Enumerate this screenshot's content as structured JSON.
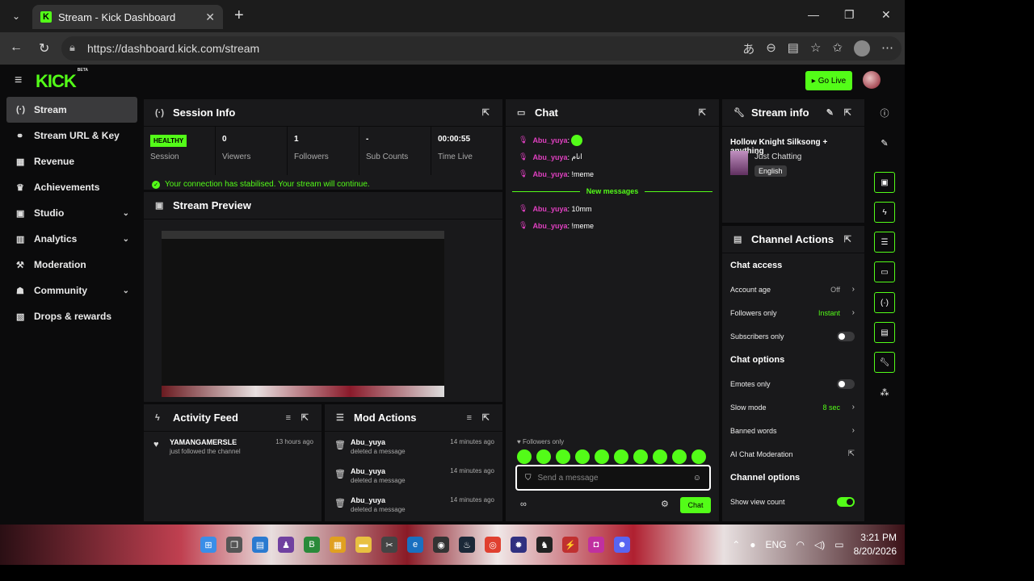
{
  "browser": {
    "tab_title": "Stream - Kick Dashboard",
    "url": "https://dashboard.kick.com/stream"
  },
  "topbar": {
    "logo": "KICK",
    "logo_badge": "BETA",
    "go_live_label": "Go Live"
  },
  "sidebar": {
    "items": [
      {
        "label": "Stream",
        "icon": "broadcast-icon",
        "active": true
      },
      {
        "label": "Stream URL & Key",
        "icon": "link-icon"
      },
      {
        "label": "Revenue",
        "icon": "revenue-icon"
      },
      {
        "label": "Achievements",
        "icon": "trophy-icon"
      },
      {
        "label": "Studio",
        "icon": "studio-icon",
        "expandable": true
      },
      {
        "label": "Analytics",
        "icon": "chart-icon",
        "expandable": true
      },
      {
        "label": "Moderation",
        "icon": "hammer-icon"
      },
      {
        "label": "Community",
        "icon": "community-icon",
        "expandable": true
      },
      {
        "label": "Drops & rewards",
        "icon": "gift-icon"
      }
    ]
  },
  "session": {
    "title": "Session Info",
    "health_badge": "HEALTHY",
    "health_label": "Session",
    "viewers_value": "0",
    "viewers_label": "Viewers",
    "followers_value": "1",
    "followers_label": "Followers",
    "subs_value": "-",
    "subs_label": "Sub Counts",
    "time_value": "00:00:55",
    "time_label": "Time Live",
    "notice": "Your connection has stabilised. Your stream will continue."
  },
  "preview": {
    "title": "Stream Preview"
  },
  "activity": {
    "title": "Activity Feed",
    "items": [
      {
        "who": "YAMANGAMERSLE",
        "what": "just followed the channel",
        "when": "13 hours ago"
      }
    ]
  },
  "mod_actions": {
    "title": "Mod Actions",
    "items": [
      {
        "who": "Abu_yuya",
        "what": "deleted a message",
        "when": "14 minutes ago"
      },
      {
        "who": "Abu_yuya",
        "what": "deleted a message",
        "when": "14 minutes ago"
      },
      {
        "who": "Abu_yuya",
        "what": "deleted a message",
        "when": "14 minutes ago"
      }
    ]
  },
  "chat": {
    "title": "Chat",
    "messages_before": [
      {
        "user": "Abu_yuya",
        "text": ""
      },
      {
        "user": "Abu_yuya",
        "text": "انام"
      },
      {
        "user": "Abu_yuya",
        "text": "!meme"
      }
    ],
    "new_messages_label": "New messages",
    "messages_after": [
      {
        "user": "Abu_yuya",
        "text": "10mm"
      },
      {
        "user": "Abu_yuya",
        "text": "!meme"
      }
    ],
    "mode_label": "Followers only",
    "input_placeholder": "Send a message",
    "send_label": "Chat",
    "emote_color": "#53fc18"
  },
  "stream_info": {
    "title": "Stream info",
    "stream_title": "Hollow Knight Silksong + anything",
    "category": "Just Chatting",
    "tag": "English"
  },
  "channel_actions": {
    "title": "Channel Actions",
    "chat_access_heading": "Chat access",
    "account_age_label": "Account age",
    "account_age_value": "Off",
    "followers_only_label": "Followers only",
    "followers_only_value": "Instant",
    "subscribers_only_label": "Subscribers only",
    "chat_options_heading": "Chat options",
    "emotes_only_label": "Emotes only",
    "slow_mode_label": "Slow mode",
    "slow_mode_value": "8 sec",
    "banned_words_label": "Banned words",
    "ai_mod_label": "AI Chat Moderation",
    "channel_options_heading": "Channel options",
    "show_view_count_label": "Show view count"
  },
  "taskbar": {
    "lang": "ENG",
    "time": "3:21 PM",
    "date": "8/20/2026"
  },
  "colors": {
    "accent": "#53fc18",
    "username": "#e040c0",
    "panel": "#19191b",
    "background": "#0b0b0c"
  }
}
